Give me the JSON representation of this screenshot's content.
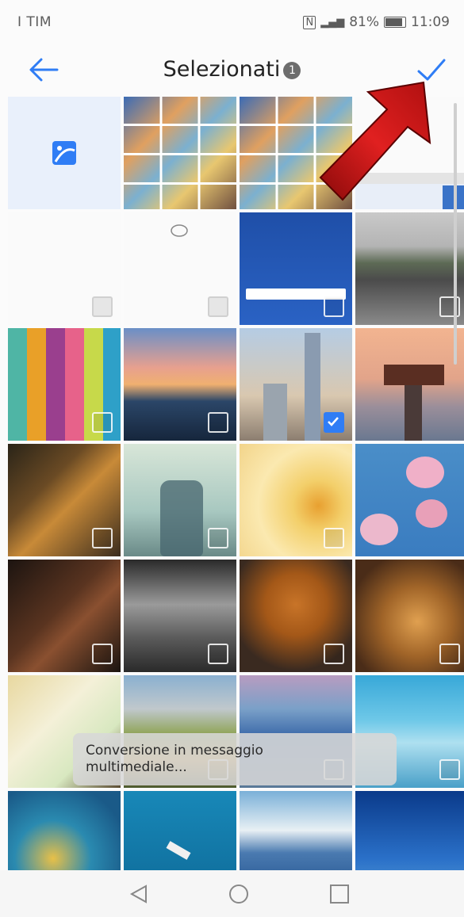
{
  "status_bar": {
    "carrier": "I TIM",
    "battery": "81%",
    "time": "11:09"
  },
  "header": {
    "title": "Selezionati",
    "selected_count": "1"
  },
  "icons": {
    "back": "arrow-left-icon",
    "confirm": "checkmark-icon",
    "gallery": "image-gallery-icon",
    "nav_back": "triangle-back-icon",
    "nav_home": "circle-home-icon",
    "nav_recents": "square-recents-icon"
  },
  "colors": {
    "accent": "#2f7df5",
    "arrow": "#d11a1a"
  },
  "grid": {
    "tiles": [
      {
        "name": "gallery-tile",
        "checkbox": false,
        "checked": false
      },
      {
        "name": "screenshot-grid-1",
        "checkbox": false,
        "checked": false
      },
      {
        "name": "screenshot-grid-2",
        "checkbox": false,
        "checked": false
      },
      {
        "name": "screenshot-browser",
        "checkbox": false,
        "checked": false
      },
      {
        "name": "blank-photo-1",
        "checkbox": true,
        "checked": false
      },
      {
        "name": "blank-photo-2",
        "checkbox": true,
        "checked": false
      },
      {
        "name": "google-search-screenshot",
        "checkbox": true,
        "checked": false
      },
      {
        "name": "parking-lot-photo",
        "checkbox": true,
        "checked": false
      },
      {
        "name": "macarons-photo",
        "checkbox": true,
        "checked": false
      },
      {
        "name": "sunset-mountains-photo",
        "checkbox": true,
        "checked": false
      },
      {
        "name": "skyscrapers-photo",
        "checkbox": true,
        "checked": true
      },
      {
        "name": "boathouse-photo",
        "checkbox": true,
        "checked": false
      },
      {
        "name": "street-night-photo",
        "checkbox": true,
        "checked": false
      },
      {
        "name": "glass-vase-photo",
        "checkbox": true,
        "checked": false
      },
      {
        "name": "yellow-flower-photo",
        "checkbox": true,
        "checked": false
      },
      {
        "name": "magnolia-photo",
        "checkbox": true,
        "checked": false
      },
      {
        "name": "violin-photo",
        "checkbox": true,
        "checked": false
      },
      {
        "name": "silver-teapots-photo",
        "checkbox": true,
        "checked": false
      },
      {
        "name": "croissant-photo",
        "checkbox": true,
        "checked": false
      },
      {
        "name": "tea-cup-photo",
        "checkbox": true,
        "checked": false
      },
      {
        "name": "lemonade-photo",
        "checkbox": true,
        "checked": false
      },
      {
        "name": "autumn-valley-photo",
        "checkbox": true,
        "checked": false
      },
      {
        "name": "sea-cliffs-photo",
        "checkbox": true,
        "checked": false
      },
      {
        "name": "ice-cave-photo",
        "checkbox": true,
        "checked": false
      },
      {
        "name": "wave-photo",
        "checkbox": false,
        "checked": false
      },
      {
        "name": "boat-sea-photo",
        "checkbox": false,
        "checked": false
      },
      {
        "name": "glacier-photo",
        "checkbox": false,
        "checked": false
      },
      {
        "name": "night-sky-photo",
        "checkbox": false,
        "checked": false
      }
    ]
  },
  "toast": {
    "line1": "Conversione in messaggio",
    "line2": "multimediale..."
  }
}
